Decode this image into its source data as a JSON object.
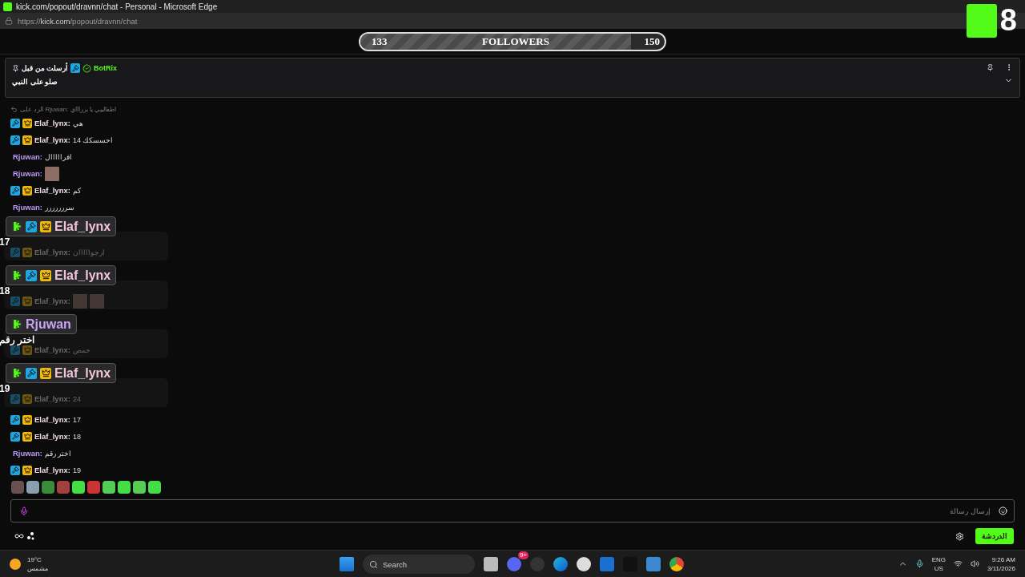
{
  "window": {
    "title": "kick.com/popout/dravnn/chat - Personal - Microsoft Edge",
    "url_host": "https://kick.com",
    "url_path": "/popout/dravnn/chat"
  },
  "followers_goal": {
    "current": "133",
    "label": "FOLLOWERS",
    "target": "150",
    "level": 0.89
  },
  "overlay_counter": {
    "value": "8"
  },
  "pinned": {
    "sent_by": "أرسلت من قبل",
    "user": "BotRix",
    "message": "صلو على النبي"
  },
  "chat": [
    {
      "kind": "reply",
      "text": "الرد على Rjuwan: اطفالييي يا بزراااي"
    },
    {
      "kind": "text",
      "moderator": true,
      "vip": true,
      "user": "Elaf_lynx:",
      "color": "#f2dfe6",
      "text": "هي",
      "dimmed": false
    },
    {
      "kind": "text",
      "moderator": true,
      "vip": true,
      "user": "Elaf_lynx:",
      "color": "#f2dfe6",
      "text": "14 احسسكك",
      "dimmed": false
    },
    {
      "kind": "text",
      "moderator": false,
      "vip": false,
      "user": "Rjuwan:",
      "color": "#b99cf5",
      "text": "افرااااال",
      "dimmed": false
    },
    {
      "kind": "emote",
      "moderator": false,
      "vip": false,
      "user": "Rjuwan:",
      "color": "#b99cf5",
      "dimmed": false
    },
    {
      "kind": "text",
      "moderator": true,
      "vip": true,
      "user": "Elaf_lynx:",
      "color": "#f2dfe6",
      "text": "كم",
      "dimmed": false
    },
    {
      "kind": "text",
      "moderator": false,
      "vip": false,
      "user": "Rjuwan:",
      "color": "#b99cf5",
      "text": "سررررررر",
      "dimmed": false
    },
    {
      "kind": "highlight",
      "card": {
        "kick": true,
        "moderator": true,
        "vip": true,
        "user": "Elaf_lynx",
        "color": "#f2c6d6"
      },
      "label": "17",
      "message": {
        "kind": "text",
        "moderator": true,
        "vip": true,
        "user": "Elaf_lynx:",
        "color": "#6e676a",
        "text": "ارجوااااان",
        "dimmed": true
      }
    },
    {
      "kind": "highlight",
      "card": {
        "kick": true,
        "moderator": true,
        "vip": true,
        "user": "Elaf_lynx",
        "color": "#f2c6d6"
      },
      "label": "18",
      "message": {
        "kind": "emote-pair",
        "moderator": true,
        "vip": true,
        "user": "Elaf_lynx:",
        "color": "#6e676a",
        "dimmed": true
      }
    },
    {
      "kind": "highlight",
      "card": {
        "kick": true,
        "moderator": false,
        "vip": false,
        "user": "Rjuwan",
        "color": "#c8a4f5"
      },
      "label": "اختر رقم",
      "message": {
        "kind": "text",
        "moderator": true,
        "vip": true,
        "user": "Elaf_lynx:",
        "color": "#6e676a",
        "text": "حمص",
        "dimmed": true
      }
    },
    {
      "kind": "highlight",
      "card": {
        "kick": true,
        "moderator": true,
        "vip": true,
        "user": "Elaf_lynx",
        "color": "#f2c6d6"
      },
      "label": "19",
      "message": {
        "kind": "text",
        "moderator": true,
        "vip": true,
        "user": "Elaf_lynx:",
        "color": "#6e676a",
        "text": "24",
        "dimmed": true
      }
    },
    {
      "kind": "text",
      "moderator": true,
      "vip": true,
      "user": "Elaf_lynx:",
      "color": "#f2dfe6",
      "text": "17",
      "dimmed": false
    },
    {
      "kind": "text",
      "moderator": true,
      "vip": true,
      "user": "Elaf_lynx:",
      "color": "#f2dfe6",
      "text": "18",
      "dimmed": false
    },
    {
      "kind": "text",
      "moderator": false,
      "vip": false,
      "user": "Rjuwan:",
      "color": "#b99cf5",
      "text": "اختر رقم",
      "dimmed": false
    },
    {
      "kind": "text",
      "moderator": true,
      "vip": true,
      "user": "Elaf_lynx:",
      "color": "#f2dfe6",
      "text": "19",
      "dimmed": false
    }
  ],
  "composer": {
    "placeholder": "إرسال رسالة",
    "chat_button": "الدردشة"
  },
  "taskbar": {
    "weather_temp": "19°C",
    "weather_text": "مشمس",
    "search": "Search",
    "discord_badge": "9+",
    "lang": "ENG",
    "region": "US",
    "time": "9:26 AM",
    "date": "3/11/2026"
  }
}
